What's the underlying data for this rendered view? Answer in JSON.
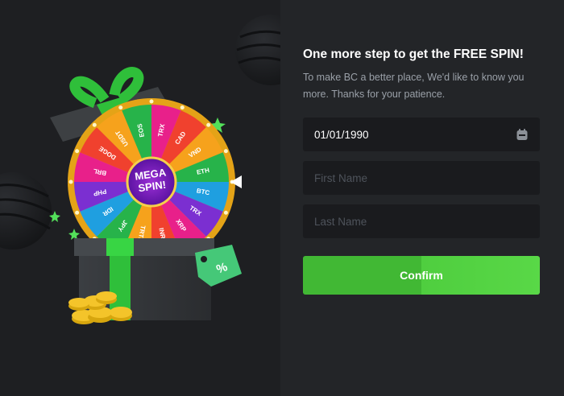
{
  "dialog": {
    "title": "One more step to get the FREE SPIN!",
    "subtitle": "To make BC a better place, We'd like to know you more. Thanks for your patience."
  },
  "form": {
    "dob_value": "01/01/1990",
    "first_name_placeholder": "First Name",
    "last_name_placeholder": "Last Name",
    "confirm_label": "Confirm"
  },
  "promo": {
    "wheel_center": "MEGA SPIN!",
    "wheel_segments": [
      "TRX",
      "CAD",
      "VND",
      "ETH",
      "BTC",
      "TRX",
      "XRP",
      "INR",
      "TRTL",
      "JPY",
      "IDR",
      "PHP",
      "BRL",
      "DOGE",
      "USDT",
      "EOS"
    ],
    "tag_symbol": "%"
  },
  "colors": {
    "accent": "#41b834",
    "background": "#1b1c1f",
    "panel": "#232528",
    "input_bg": "#1a1b1e"
  },
  "icons": {
    "calendar": "calendar-icon"
  }
}
